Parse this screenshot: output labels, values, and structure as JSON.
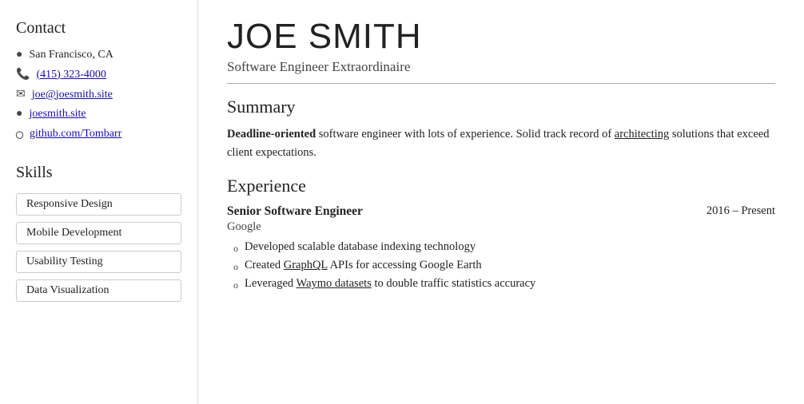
{
  "sidebar": {
    "contact_title": "Contact",
    "location": "San Francisco, CA",
    "phone": "(415) 323-4000",
    "email": "joe@joesmith.site",
    "website": "joesmith.site",
    "github": "github.com/Tombarr",
    "skills_title": "Skills",
    "skills": [
      "Responsive Design",
      "Mobile Development",
      "Usability Testing",
      "Data Visualization"
    ]
  },
  "main": {
    "name": "JOE SMITH",
    "title": "Software Engineer Extraordinaire",
    "summary_heading": "Summary",
    "summary_text_bold": "Deadline-oriented",
    "summary_text_rest": " software engineer with lots of experience. Solid track record of ",
    "summary_word_underline": "architecting",
    "summary_text_end": " solutions that exceed client expectations.",
    "experience_heading": "Experience",
    "jobs": [
      {
        "title": "Senior Software Engineer",
        "company": "Google",
        "dates": "2016 – Present",
        "bullets": [
          "Developed scalable database indexing technology",
          "Created <u>GraphQL</u> APIs for accessing Google Earth",
          "Leveraged <u>Waymo datasets</u> to double traffic statistics accuracy"
        ]
      }
    ]
  },
  "icons": {
    "location": "📍",
    "phone": "📞",
    "email": "✉",
    "website": "🌐",
    "github": "⊙"
  }
}
